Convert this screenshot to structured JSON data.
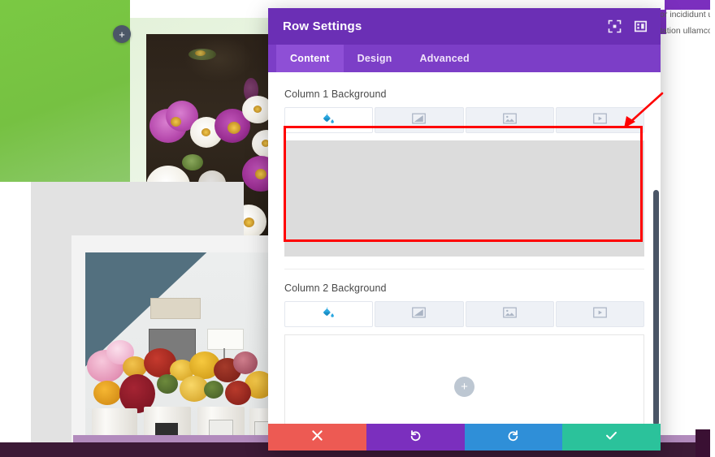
{
  "background_page": {
    "add_row_button_label": "+",
    "side_text_lines": [
      "or incididunt ut",
      "tation ullamco"
    ],
    "green_panel_color": "#7ac943",
    "photo_top_alt": "purple and white cosmos flowers",
    "photo_bottom_alt": "flower market buckets"
  },
  "modal": {
    "title": "Row Settings",
    "header_icons": [
      {
        "name": "focus-icon",
        "glyph": "focus"
      },
      {
        "name": "layout-columns-icon",
        "glyph": "layout"
      }
    ],
    "tabs": [
      {
        "label": "Content",
        "active": true
      },
      {
        "label": "Design",
        "active": false
      },
      {
        "label": "Advanced",
        "active": false
      }
    ],
    "sections": [
      {
        "label": "Column 1 Background",
        "type_tabs": [
          {
            "name": "background-color-tab",
            "icon": "paint-bucket-icon",
            "active": true
          },
          {
            "name": "background-gradient-tab",
            "icon": "gradient-icon",
            "active": false
          },
          {
            "name": "background-image-tab",
            "icon": "image-icon",
            "active": false
          },
          {
            "name": "background-video-tab",
            "icon": "video-icon",
            "active": false
          }
        ],
        "canvas_state": "filled-gray",
        "canvas_color": "#dcdcdc",
        "highlighted": true
      },
      {
        "label": "Column 2 Background",
        "type_tabs": [
          {
            "name": "background-color-tab",
            "icon": "paint-bucket-icon",
            "active": true
          },
          {
            "name": "background-gradient-tab",
            "icon": "gradient-icon",
            "active": false
          },
          {
            "name": "background-image-tab",
            "icon": "image-icon",
            "active": false
          },
          {
            "name": "background-video-tab",
            "icon": "video-icon",
            "active": false
          }
        ],
        "canvas_state": "empty",
        "add_button_label": "+",
        "highlighted": false
      }
    ],
    "footer": [
      {
        "name": "cancel-button",
        "icon": "close-icon",
        "color": "#ed5a53"
      },
      {
        "name": "undo-button",
        "icon": "undo-icon",
        "color": "#7b2fbe"
      },
      {
        "name": "redo-button",
        "icon": "redo-icon",
        "color": "#2f8fd8"
      },
      {
        "name": "save-button",
        "icon": "check-icon",
        "color": "#2bc29b"
      }
    ],
    "accent_header_color": "#6b2fb5",
    "accent_tabs_color": "#7c3ec7"
  },
  "annotations": {
    "highlight_color": "#ff0000",
    "box_target": "Column 1 Background color swatch area",
    "arrow_target": "Column 1 Background color swatch area"
  }
}
